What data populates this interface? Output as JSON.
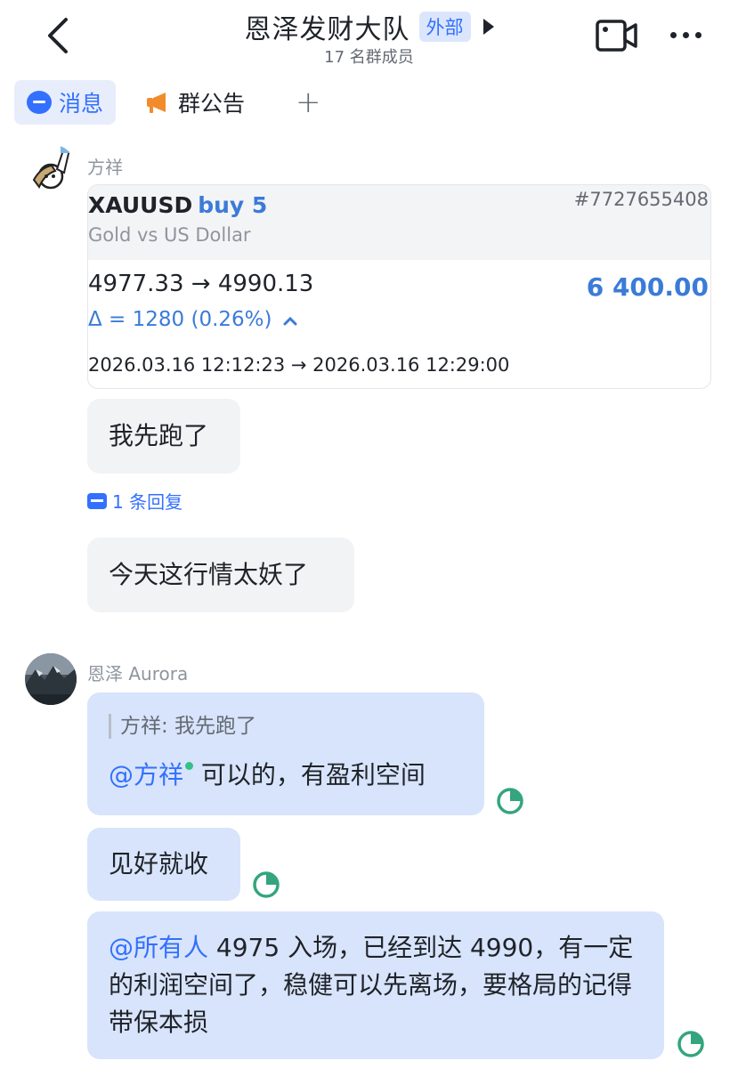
{
  "header": {
    "title": "恩泽发财大队",
    "external_tag": "外部",
    "member_count": "17 名群成员"
  },
  "tabs": [
    {
      "label": "消息",
      "icon": "message-icon"
    },
    {
      "label": "群公告",
      "icon": "megaphone-icon"
    },
    {
      "label": "+",
      "icon": "plus-icon"
    }
  ],
  "messages": {
    "m1": {
      "sender": "方祥",
      "card": {
        "symbol": "XAUUSD",
        "action": "buy 5",
        "order_id": "#7727655408",
        "pair_name": "Gold vs US Dollar",
        "price_change": "4977.33 → 4990.13",
        "profit": "6 400.00",
        "delta": "Δ = 1280 (0.26%)",
        "times": "2026.03.16 12:12:23 → 2026.03.16 12:29:00"
      },
      "bubble1": "我先跑了",
      "reply_link": "1 条回复",
      "bubble2": "今天这行情太妖了"
    },
    "m2": {
      "sender": "恩泽 Aurora",
      "quote": "方祥: 我先跑了",
      "mention1": "@方祥",
      "text1": "可以的，有盈利空间",
      "bubble2": "见好就收",
      "mention2": "@所有人",
      "text3": "4975 入场，已经到达 4990，有一定的利润空间了，稳健可以先离场，要格局的记得带保本损"
    }
  },
  "colors": {
    "accent": "#3370ff",
    "profit_blue": "#3b7bd8",
    "bubble_grey": "#f2f3f5",
    "bubble_blue": "#d8e4fb",
    "read_green": "#34a57d"
  }
}
